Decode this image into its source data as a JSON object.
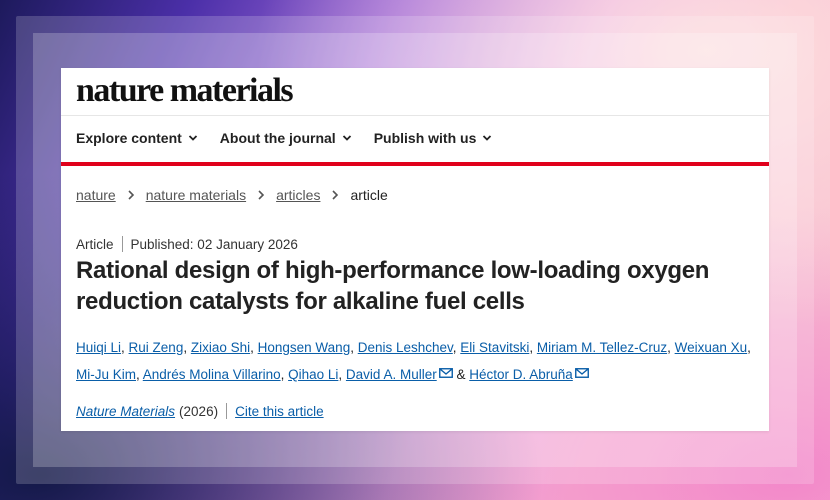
{
  "site": {
    "logo": "nature materials"
  },
  "nav": {
    "items": [
      {
        "label": "Explore content"
      },
      {
        "label": "About the journal"
      },
      {
        "label": "Publish with us"
      }
    ]
  },
  "breadcrumb": {
    "items": [
      "nature",
      "nature materials",
      "articles"
    ],
    "current": "article"
  },
  "article": {
    "type": "Article",
    "published": "Published: 02 January 2026",
    "title": "Rational design of high-performance low-loading oxygen reduction catalysts for alkaline fuel cells",
    "authors": [
      "Huiqi Li",
      "Rui Zeng",
      "Zixiao Shi",
      "Hongsen Wang",
      "Denis Leshchev",
      "Eli Stavitski",
      "Miriam M. Tellez-Cruz",
      "Weixuan Xu",
      "Mi-Ju Kim",
      "Andrés Molina Villarino",
      "Qihao Li",
      "David A. Muller",
      "Héctor D. Abruña"
    ],
    "author_joiner": "&",
    "journal": "Nature Materials",
    "year": "(2026)",
    "cite_label": "Cite this article"
  },
  "colors": {
    "accent_red": "#e0001b",
    "link_blue": "#0a5ea8"
  },
  "icons": {
    "nav_chevron": "chevron-down-icon",
    "breadcrumb_separator": "chevron-right-icon",
    "corresponding_author": "envelope-icon"
  }
}
